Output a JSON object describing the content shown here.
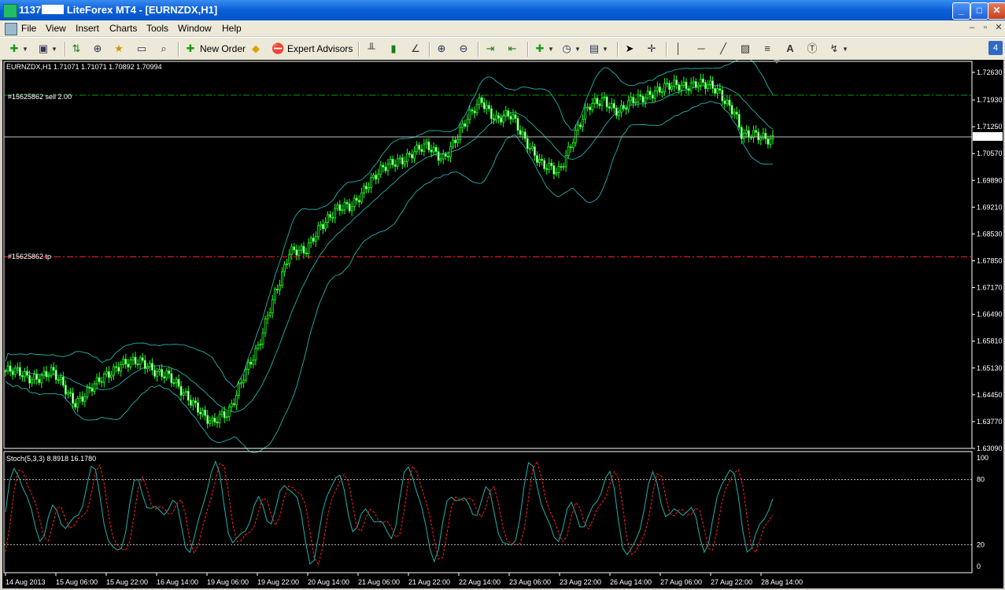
{
  "window": {
    "title_prefix": "1137",
    "title_main": " LiteForex MT4 - [EURNZDX,H1]",
    "minimize": "_",
    "maximize": "□",
    "close": "✕"
  },
  "menu": {
    "items": [
      "File",
      "View",
      "Insert",
      "Charts",
      "Tools",
      "Window",
      "Help"
    ],
    "mdi": [
      "–",
      "▫",
      "✕"
    ]
  },
  "toolbar": {
    "new_order": "New Order",
    "expert_advisors": "Expert Advisors",
    "text_tool": "A",
    "badge": "4"
  },
  "chart": {
    "header": "EURNZDX,H1  1.71071 1.71071 1.70892 1.70994",
    "current_price": 1.70994,
    "current_price_label": "1.70994",
    "order_label": "#15625862 sell 2.00",
    "order_price": 1.7205,
    "tp_label": "#15625862 tp",
    "tp_price": 1.6795,
    "price_ticks": [
      "1.72630",
      "1.71930",
      "1.71250",
      "1.70570",
      "1.69890",
      "1.69210",
      "1.68530",
      "1.67850",
      "1.67170",
      "1.66490",
      "1.65810",
      "1.65130",
      "1.64450",
      "1.63770",
      "1.63090"
    ],
    "time_ticks": [
      "14 Aug 2013",
      "15 Aug 06:00",
      "15 Aug 22:00",
      "16 Aug 14:00",
      "19 Aug 06:00",
      "19 Aug 22:00",
      "20 Aug 14:00",
      "21 Aug 06:00",
      "21 Aug 22:00",
      "22 Aug 14:00",
      "23 Aug 06:00",
      "23 Aug 22:00",
      "26 Aug 14:00",
      "27 Aug 06:00",
      "27 Aug 22:00",
      "28 Aug 14:00"
    ],
    "colors": {
      "candle": "#22ff22",
      "bands": "#20b2aa",
      "grid_line": "#00a000",
      "tp_line": "#ff2020",
      "stoch_main": "#20b2aa",
      "stoch_signal": "#ff2020"
    }
  },
  "stoch": {
    "label": "Stoch(5,3,3) 8.8918 16.1780",
    "levels": [
      "100",
      "80",
      "20",
      "0"
    ]
  },
  "chart_data": {
    "type": "line",
    "title": "EURNZDX,H1",
    "x_range": [
      "14 Aug 2013",
      "28 Aug 14:00"
    ],
    "ylim": [
      1.6309,
      1.7263
    ],
    "series": [
      {
        "name": "close",
        "x_frac": [
          0,
          0.03,
          0.06,
          0.09,
          0.12,
          0.15,
          0.18,
          0.21,
          0.23,
          0.25,
          0.27,
          0.29,
          0.31,
          0.33,
          0.35,
          0.37,
          0.39,
          0.41,
          0.43,
          0.45,
          0.47,
          0.49,
          0.51,
          0.53,
          0.55,
          0.57,
          0.59,
          0.62,
          0.64,
          0.66,
          0.68,
          0.7,
          0.72,
          0.74,
          0.76,
          0.78,
          0.8,
          0.82,
          0.84,
          0.86,
          0.88,
          0.9,
          0.91,
          0.93,
          0.95,
          0.96,
          0.97,
          0.98
        ],
        "values": [
          1.6505,
          1.649,
          1.65,
          1.643,
          1.647,
          1.653,
          1.652,
          1.65,
          1.6445,
          1.642,
          1.637,
          1.6395,
          1.65,
          1.656,
          1.67,
          1.681,
          1.68,
          1.688,
          1.691,
          1.692,
          1.698,
          1.701,
          1.704,
          1.706,
          1.707,
          1.705,
          1.71,
          1.72,
          1.714,
          1.715,
          1.709,
          1.702,
          1.701,
          1.71,
          1.717,
          1.72,
          1.716,
          1.719,
          1.7215,
          1.722,
          1.723,
          1.724,
          1.723,
          1.721,
          1.717,
          1.71,
          1.7098,
          1.70994
        ]
      }
    ]
  }
}
